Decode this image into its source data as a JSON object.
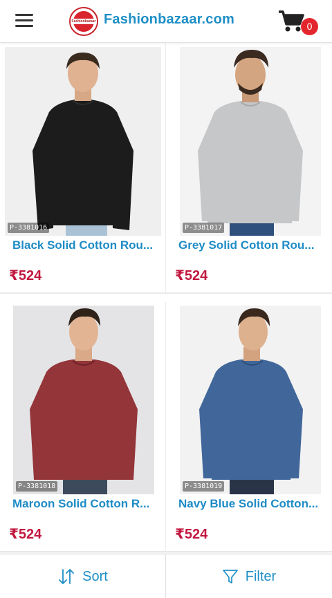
{
  "header": {
    "logo_text": "Fashionbazaar",
    "brand": "Fashionbazaar.com",
    "cart_count": "0"
  },
  "products": [
    {
      "id": "P-3381016",
      "title": "Black Solid Cotton Rou...",
      "price": "₹524",
      "color": "#1c1c1c"
    },
    {
      "id": "P-3381017",
      "title": "Grey Solid Cotton Rou...",
      "price": "₹524",
      "color": "#c6c7c9"
    },
    {
      "id": "P-3381018",
      "title": "Maroon Solid Cotton R...",
      "price": "₹524",
      "color": "#94353a"
    },
    {
      "id": "P-3381019",
      "title": "Navy Blue Solid Cotton...",
      "price": "₹524",
      "color": "#41679a"
    }
  ],
  "bottom_bar": {
    "sort_label": "Sort",
    "filter_label": "Filter"
  },
  "colors": {
    "accent": "#1e8fc6",
    "price": "#c2183f",
    "badge": "#e3262d"
  }
}
